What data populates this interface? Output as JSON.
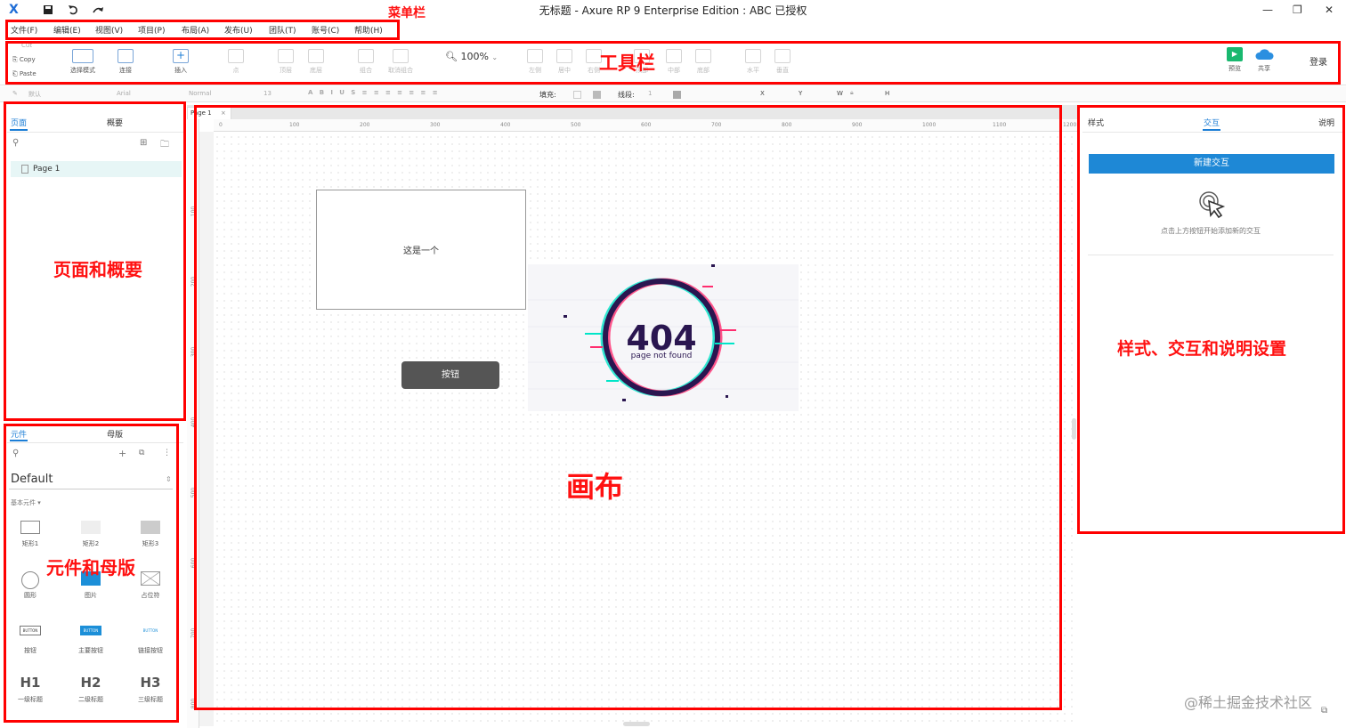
{
  "window": {
    "title": "无标题 - Axure RP 9 Enterprise Edition : ABC 已授权",
    "logo": "X",
    "save_icon": "save-icon",
    "undo_icon": "undo-icon",
    "redo_icon": "redo-icon"
  },
  "menu": [
    "文件(F)",
    "编辑(E)",
    "视图(V)",
    "项目(P)",
    "布局(A)",
    "发布(U)",
    "团队(T)",
    "账号(C)",
    "帮助(H)"
  ],
  "toolbar": {
    "cut": "Cut",
    "copy": "Copy",
    "paste": "Paste",
    "select_mode": "选择模式",
    "connect": "连接",
    "insert": "插入",
    "point": "点",
    "top_layer": "顶层",
    "bottom_layer": "底层",
    "group": "组合",
    "ungroup": "取消组合",
    "zoom": "100%",
    "align_left": "左侧",
    "align_center": "居中",
    "align_right": "右侧",
    "align_top": "顶部",
    "align_middle": "中部",
    "align_bottom": "底部",
    "dist_h": "水平",
    "dist_v": "垂直",
    "preview": "预览",
    "share": "共享",
    "login": "登录"
  },
  "stylebar": {
    "style": "默认",
    "font": "Arial",
    "weight": "Normal",
    "size": "13",
    "fill": "填充:",
    "line": "线段:",
    "line_width": "1",
    "x": "X",
    "y": "Y",
    "w": "W",
    "h": "H"
  },
  "pages_panel": {
    "tabs": [
      "页面",
      "概要"
    ],
    "page": "Page 1"
  },
  "libraries_panel": {
    "tabs": [
      "元件",
      "母版"
    ],
    "library": "Default",
    "section": "基本元件 ▾",
    "widgets": [
      {
        "label": "矩形1",
        "icon": "rectangle-icon"
      },
      {
        "label": "矩形2",
        "icon": "rectangle-icon"
      },
      {
        "label": "矩形3",
        "icon": "rectangle-icon"
      },
      {
        "label": "圆形",
        "icon": "circle-icon"
      },
      {
        "label": "图片",
        "icon": "image-icon"
      },
      {
        "label": "占位符",
        "icon": "placeholder-icon"
      },
      {
        "label": "按钮",
        "icon": "button-icon",
        "glyph": "BUTTON"
      },
      {
        "label": "主要按钮",
        "icon": "primary-button-icon",
        "glyph": "BUTTON"
      },
      {
        "label": "链接按钮",
        "icon": "link-button-icon",
        "glyph": "BUTTON"
      },
      {
        "label": "一级标题",
        "icon": "h1-icon",
        "glyph": "H1"
      },
      {
        "label": "二级标题",
        "icon": "h2-icon",
        "glyph": "H2"
      },
      {
        "label": "三级标题",
        "icon": "h3-icon",
        "glyph": "H3"
      }
    ]
  },
  "canvas": {
    "page_tab": "Page 1",
    "ruler_h": [
      "0",
      "100",
      "200",
      "300",
      "400",
      "500",
      "600",
      "700",
      "800",
      "900",
      "1000",
      "1100",
      "1200"
    ],
    "ruler_v": [
      "100",
      "200",
      "300",
      "400",
      "500",
      "600",
      "700",
      "800"
    ],
    "rect_text": "这是一个",
    "button_text": "按钮",
    "img_404": "404",
    "img_404_sub": "page not found"
  },
  "right_panel": {
    "tabs": [
      "样式",
      "交互",
      "说明"
    ],
    "new_interaction": "新建交互",
    "hint": "点击上方按钮开始添加新的交互"
  },
  "annotations": {
    "menubar": "菜单栏",
    "toolbar": "工具栏",
    "pages": "页面和概要",
    "widgets": "元件和母版",
    "canvas": "画布",
    "settings": "样式、交互和说明设置"
  },
  "watermark": "@稀土掘金技术社区",
  "colors": {
    "annotation": "#ff0000",
    "accent": "#1c7ed6",
    "button": "#555555"
  }
}
